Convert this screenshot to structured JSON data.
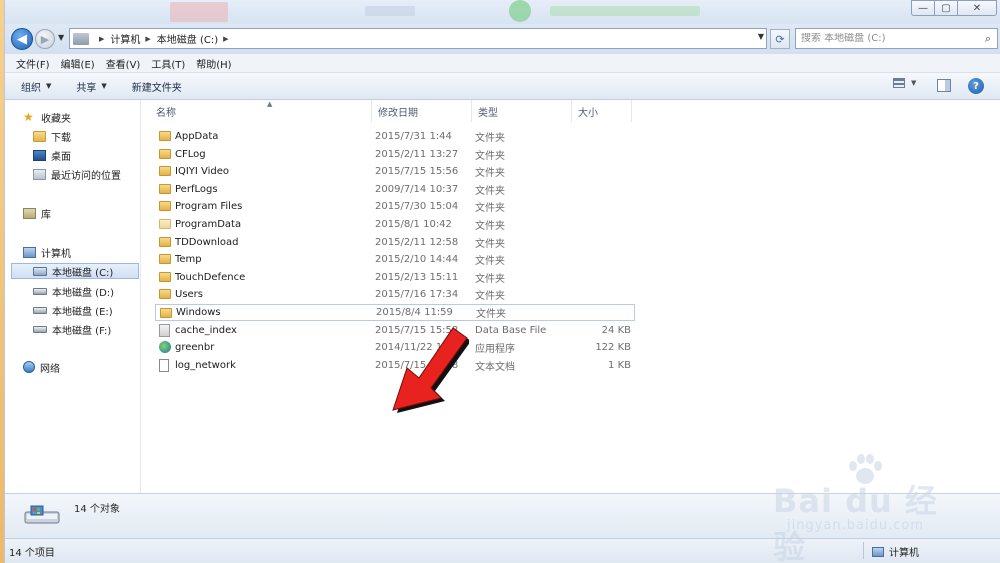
{
  "window": {
    "controls": {
      "minimize": "—",
      "maximize": "▢",
      "close": "✕"
    }
  },
  "address": {
    "crumbs": [
      "计算机",
      "本地磁盘 (C:)"
    ],
    "search_placeholder": "搜索 本地磁盘 (C:)"
  },
  "menu": [
    "文件(F)",
    "编辑(E)",
    "查看(V)",
    "工具(T)",
    "帮助(H)"
  ],
  "toolbar": {
    "organize": "组织",
    "share": "共享",
    "new_folder": "新建文件夹",
    "help": "?"
  },
  "nav": {
    "favorites": "收藏夹",
    "downloads": "下载",
    "desktop": "桌面",
    "recent": "最近访问的位置",
    "libraries": "库",
    "computer": "计算机",
    "drive_c": "本地磁盘 (C:)",
    "drive_d": "本地磁盘 (D:)",
    "drive_e": "本地磁盘 (E:)",
    "drive_f": "本地磁盘 (F:)",
    "network": "网络"
  },
  "columns": {
    "name": "名称",
    "date": "修改日期",
    "type": "类型",
    "size": "大小"
  },
  "files": [
    {
      "name": "AppData",
      "date": "2015/7/31 1:44",
      "type": "文件夹",
      "size": "",
      "icon": "folder"
    },
    {
      "name": "CFLog",
      "date": "2015/2/11 13:27",
      "type": "文件夹",
      "size": "",
      "icon": "folder"
    },
    {
      "name": "IQIYI Video",
      "date": "2015/7/15 15:56",
      "type": "文件夹",
      "size": "",
      "icon": "folder"
    },
    {
      "name": "PerfLogs",
      "date": "2009/7/14 10:37",
      "type": "文件夹",
      "size": "",
      "icon": "folder"
    },
    {
      "name": "Program Files",
      "date": "2015/7/30 15:04",
      "type": "文件夹",
      "size": "",
      "icon": "folder"
    },
    {
      "name": "ProgramData",
      "date": "2015/8/1 10:42",
      "type": "文件夹",
      "size": "",
      "icon": "folder-light"
    },
    {
      "name": "TDDownload",
      "date": "2015/2/11 12:58",
      "type": "文件夹",
      "size": "",
      "icon": "folder"
    },
    {
      "name": "Temp",
      "date": "2015/2/10 14:44",
      "type": "文件夹",
      "size": "",
      "icon": "folder"
    },
    {
      "name": "TouchDefence",
      "date": "2015/2/13 15:11",
      "type": "文件夹",
      "size": "",
      "icon": "folder"
    },
    {
      "name": "Users",
      "date": "2015/7/16 17:34",
      "type": "文件夹",
      "size": "",
      "icon": "folder"
    },
    {
      "name": "Windows",
      "date": "2015/8/4 11:59",
      "type": "文件夹",
      "size": "",
      "icon": "folder",
      "selected": true
    },
    {
      "name": "cache_index",
      "date": "2015/7/15 15:58",
      "type": "Data Base File",
      "size": "24 KB",
      "icon": "db"
    },
    {
      "name": "greenbr",
      "date": "2014/11/22 17:29",
      "type": "应用程序",
      "size": "122 KB",
      "icon": "app"
    },
    {
      "name": "log_network",
      "date": "2015/7/15 15:58",
      "type": "文本文档",
      "size": "1 KB",
      "icon": "txt"
    }
  ],
  "details": {
    "count": "14 个对象"
  },
  "status": {
    "left": "14 个项目",
    "right": "计算机"
  },
  "watermark": {
    "main": "Bai du 经验",
    "sub": "jingyan.baidu.com"
  },
  "colors": {
    "accent": "#1d5fb5",
    "arrow": "#e8221e",
    "selection": "#b7cbe6"
  }
}
